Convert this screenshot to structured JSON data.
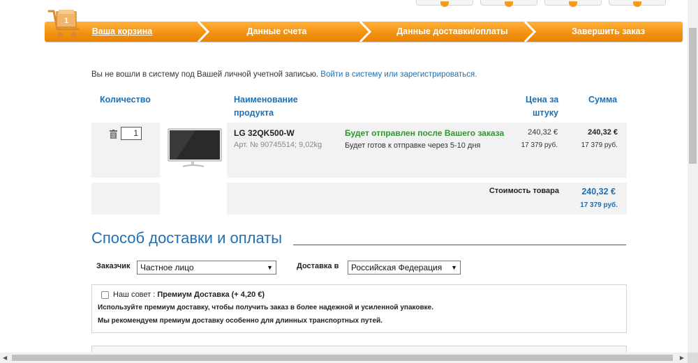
{
  "top_tabs": [
    "",
    "",
    "",
    ""
  ],
  "cart": {
    "count": "1"
  },
  "progress_steps": [
    {
      "label": "Ваша корзина",
      "active": true
    },
    {
      "label": "Данные счета",
      "active": false
    },
    {
      "label": "Данные доставки/оплаты",
      "active": false
    },
    {
      "label": "Завершить заказ",
      "active": false
    }
  ],
  "notice": {
    "text": "Вы не вошли в систему под Вашей личной учетной записью.",
    "link": "Войти в систему или зарегистрироваться."
  },
  "table": {
    "col_qty": "Количество",
    "col_name_1": "Наименование",
    "col_name_2": "продукта",
    "col_price_1": "Цена за",
    "col_price_2": "штуку",
    "col_sum": "Сумма"
  },
  "item": {
    "qty": "1",
    "name": "LG 32QK500-W",
    "sku": "Арт. № 90745514; 9,02kg",
    "shipping": "Будет отправлен после Вашего заказа",
    "ready": "Будет готов к отправке через 5-10 дня",
    "price_eur": "240,32 €",
    "price_rub": "17 379 руб.",
    "sum_eur": "240,32 €",
    "sum_rub": "17 379 руб."
  },
  "totals": {
    "label": "Стоимость товара",
    "eur": "240,32 €",
    "rub": "17 379 руб."
  },
  "delivery": {
    "title": "Способ доставки и оплаты",
    "customer_label": "Заказчик",
    "customer_value": "Частное лицо",
    "country_label": "Доставка в",
    "country_value": "Российская Федерация"
  },
  "advice": {
    "prefix": "Наш совет : ",
    "option": "Премиум Доставка (+ 4,20 €)",
    "line1": "Используйте премиум доставку, чтобы получить заказ в более надежной и усиленной упаковке.",
    "line2": "Мы рекомендуем премиум доставку особенно для длинных транспортных путей."
  },
  "colors": {
    "accent_orange": "#f39312",
    "link_blue": "#1f6fb2",
    "ship_green": "#2a9a2a"
  }
}
